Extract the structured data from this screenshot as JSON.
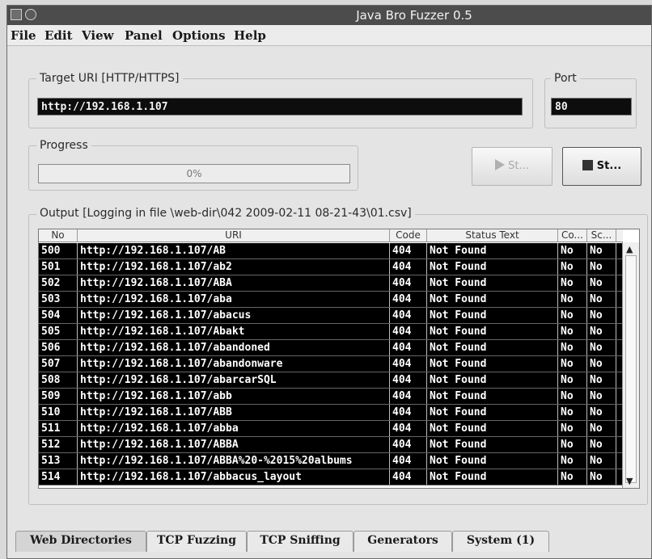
{
  "window": {
    "title": "Java Bro Fuzzer 0.5"
  },
  "menu": [
    "File",
    "Edit",
    "View",
    "Panel",
    "Options",
    "Help"
  ],
  "target": {
    "legend": "Target URI [HTTP/HTTPS]",
    "value": "http://192.168.1.107"
  },
  "port": {
    "legend": "Port",
    "value": "80"
  },
  "progress": {
    "legend": "Progress",
    "value": "0%",
    "fraction": 0
  },
  "buttons": {
    "start_label": "St...",
    "stop_label": "St..."
  },
  "output": {
    "legend": "Output [Logging in file \\web-dir\\042 2009-02-11 08-21-43\\01.csv]",
    "columns": [
      "No",
      "URI",
      "Code",
      "Status Text",
      "Co...",
      "Sc..."
    ],
    "rows": [
      [
        "500",
        "http://192.168.1.107/AB",
        "404",
        "Not Found",
        "No",
        "No"
      ],
      [
        "501",
        "http://192.168.1.107/ab2",
        "404",
        "Not Found",
        "No",
        "No"
      ],
      [
        "502",
        "http://192.168.1.107/ABA",
        "404",
        "Not Found",
        "No",
        "No"
      ],
      [
        "503",
        "http://192.168.1.107/aba",
        "404",
        "Not Found",
        "No",
        "No"
      ],
      [
        "504",
        "http://192.168.1.107/abacus",
        "404",
        "Not Found",
        "No",
        "No"
      ],
      [
        "505",
        "http://192.168.1.107/Abakt",
        "404",
        "Not Found",
        "No",
        "No"
      ],
      [
        "506",
        "http://192.168.1.107/abandoned",
        "404",
        "Not Found",
        "No",
        "No"
      ],
      [
        "507",
        "http://192.168.1.107/abandonware",
        "404",
        "Not Found",
        "No",
        "No"
      ],
      [
        "508",
        "http://192.168.1.107/abarcarSQL",
        "404",
        "Not Found",
        "No",
        "No"
      ],
      [
        "509",
        "http://192.168.1.107/abb",
        "404",
        "Not Found",
        "No",
        "No"
      ],
      [
        "510",
        "http://192.168.1.107/ABB",
        "404",
        "Not Found",
        "No",
        "No"
      ],
      [
        "511",
        "http://192.168.1.107/abba",
        "404",
        "Not Found",
        "No",
        "No"
      ],
      [
        "512",
        "http://192.168.1.107/ABBA",
        "404",
        "Not Found",
        "No",
        "No"
      ],
      [
        "513",
        "http://192.168.1.107/ABBA%20-%2015%20albums",
        "404",
        "Not Found",
        "No",
        "No"
      ],
      [
        "514",
        "http://192.168.1.107/abbacus_layout",
        "404",
        "Not Found",
        "No",
        "No"
      ]
    ]
  },
  "tabs": [
    "Web Directories",
    "TCP Fuzzing",
    "TCP Sniffing",
    "Generators",
    "System (1)"
  ],
  "selected_tab": "Web Directories"
}
